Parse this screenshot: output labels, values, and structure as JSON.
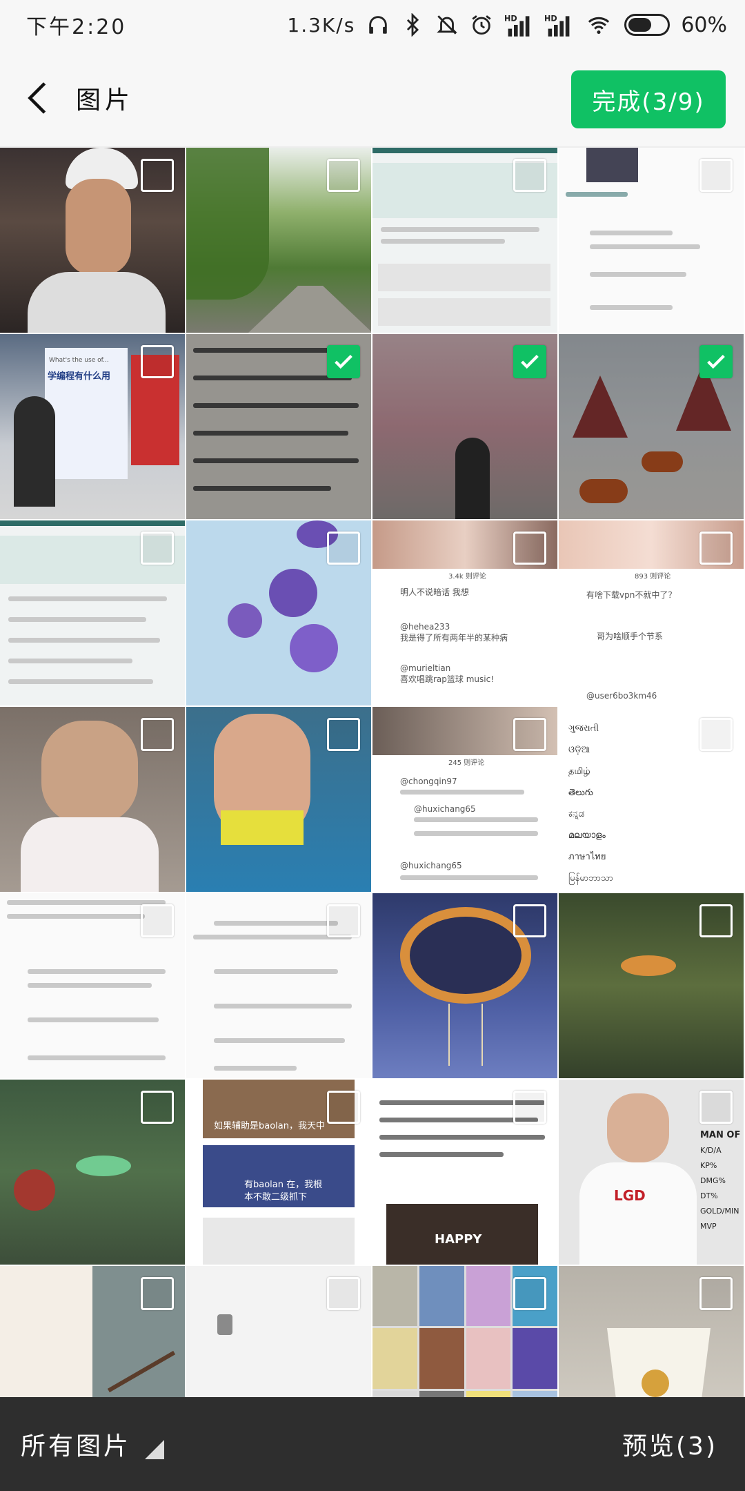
{
  "status_bar": {
    "time": "下午2:20",
    "net_speed": "1.3K/s",
    "signal_labels": [
      "HD",
      "HD"
    ],
    "battery": "60%",
    "battery_level": 0.6
  },
  "header": {
    "back_icon": "chevron-left-icon",
    "title": "图片",
    "done_label": "完成(3/9)"
  },
  "grid": {
    "colors": {
      "accent": "#10c164",
      "checkbox": "#ffffff"
    },
    "selected_indices": [
      5,
      6,
      7
    ],
    "texts": {
      "c3_comments_a": "3.4k 则评论",
      "c3_comment_1": "明人不说暗话 我想",
      "c3_user_2": "@hehea233",
      "c3_comment_2": "我是得了所有两年半的某种病",
      "c3_user_3": "@murieltian",
      "c3_comment_3": "喜欢唱跳rap篮球 music!",
      "c4_comments": "893 则评论",
      "c4_comment_1": "有啥下载vpn不就中了？",
      "c4_comment_2": "哥为啥顺手个节系",
      "c4_user_3": "@user6bo3km46",
      "c7_comments": "245 则评论",
      "c7_user_1": "@chongqin97",
      "c7_user_2": "@huxichang65",
      "c7_user_3": "@huxichang65",
      "c8_langs": [
        "ગુજરાતી",
        "ଓଡ଼ିଆ",
        "தமிழ்",
        "తెలుగు",
        "ಕನ್ನಡ",
        "മലയാളം",
        "ภาษาไทย",
        "မြန်မာဘာသာ"
      ],
      "c18_caption_1": "如果辅助是baolan，我天中",
      "c18_caption_2": "有baolan 在，我根",
      "c18_caption_3": "本不敢二级抓下",
      "c19_happy": "HAPPY",
      "c20_brand": "LGD",
      "c20_stats": [
        "MAN OF",
        "K/D/A",
        "KP%",
        "DMG%",
        "DT%",
        "GOLD/MIN",
        "MVP"
      ],
      "c11_title": "What's the use of...",
      "c11_banner": "学编程有什么用"
    }
  },
  "bottom_bar": {
    "album_label": "所有图片",
    "preview_label": "预览(3)"
  }
}
